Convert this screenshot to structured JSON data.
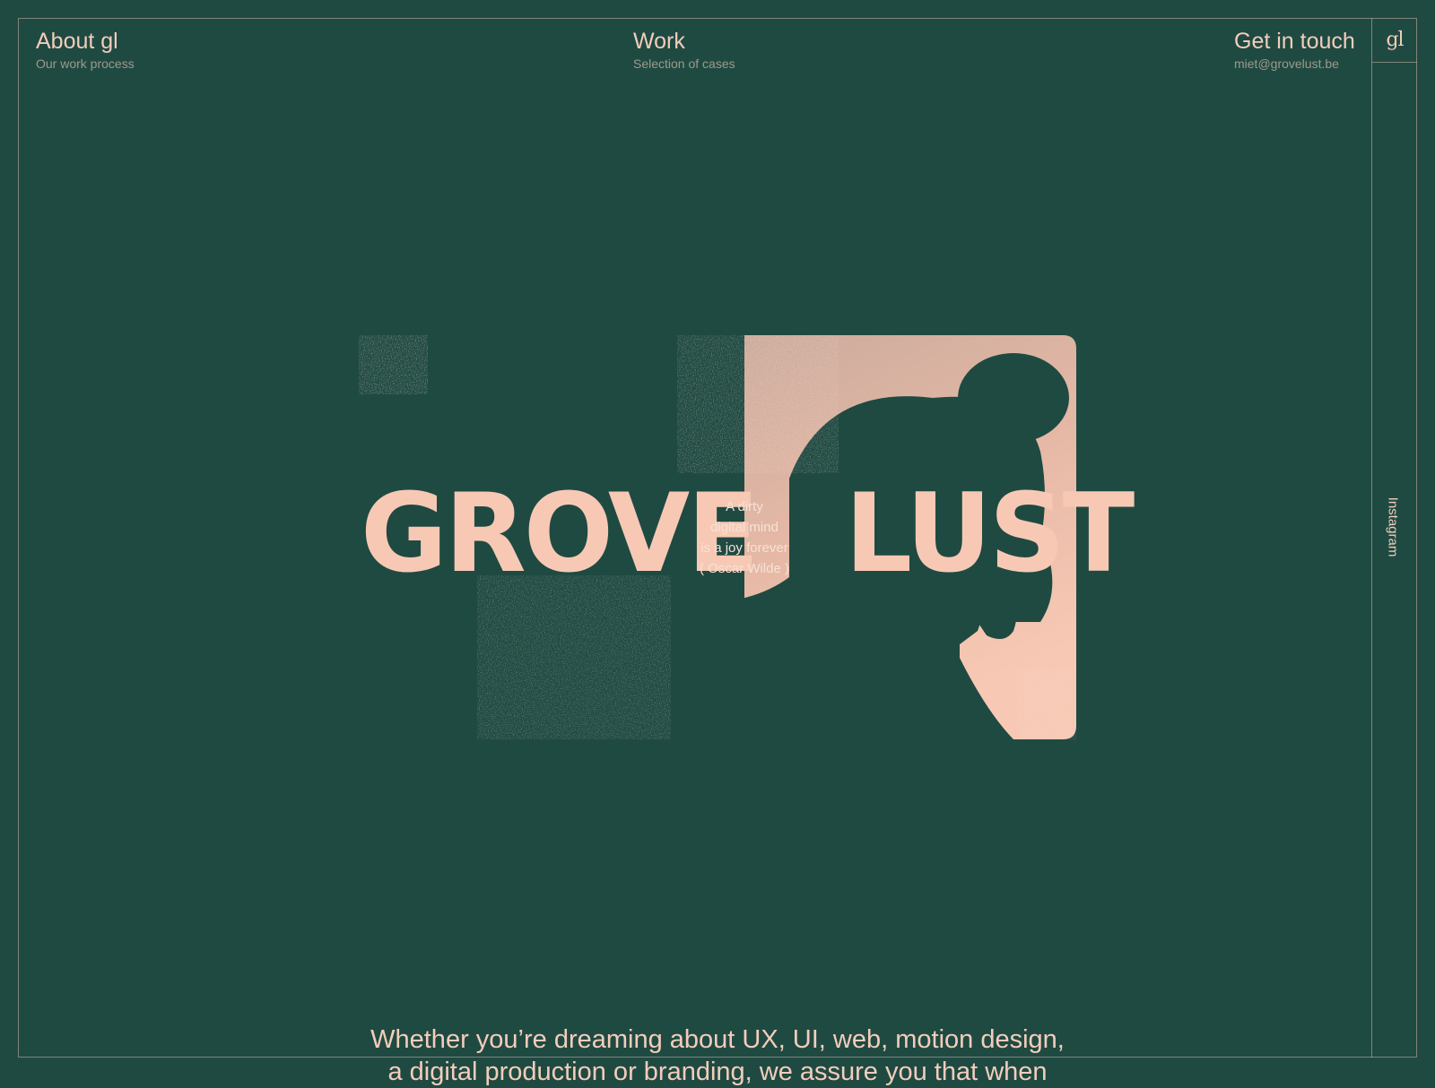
{
  "nav": {
    "about": {
      "title": "About gl",
      "subtitle": "Our work process"
    },
    "work": {
      "title": "Work",
      "subtitle": "Selection of cases"
    },
    "contact": {
      "title": "Get in touch",
      "subtitle": "miet@grovelust.be"
    }
  },
  "rail": {
    "logo": "gl",
    "instagram": "Instagram"
  },
  "hero": {
    "word_left": "GROVE",
    "word_right": "LUST",
    "quote_lines": [
      "A dirty",
      "digital mind",
      "is a joy forever",
      "( Oscar Wilde )"
    ]
  },
  "tagline": {
    "line1": "Whether you’re dreaming about UX, UI, web, motion design,",
    "line2": "a digital production or branding, we assure you that when"
  },
  "colors": {
    "background": "#1f4a42",
    "accent": "#f3cdbb",
    "border": "#f3cdbb"
  }
}
